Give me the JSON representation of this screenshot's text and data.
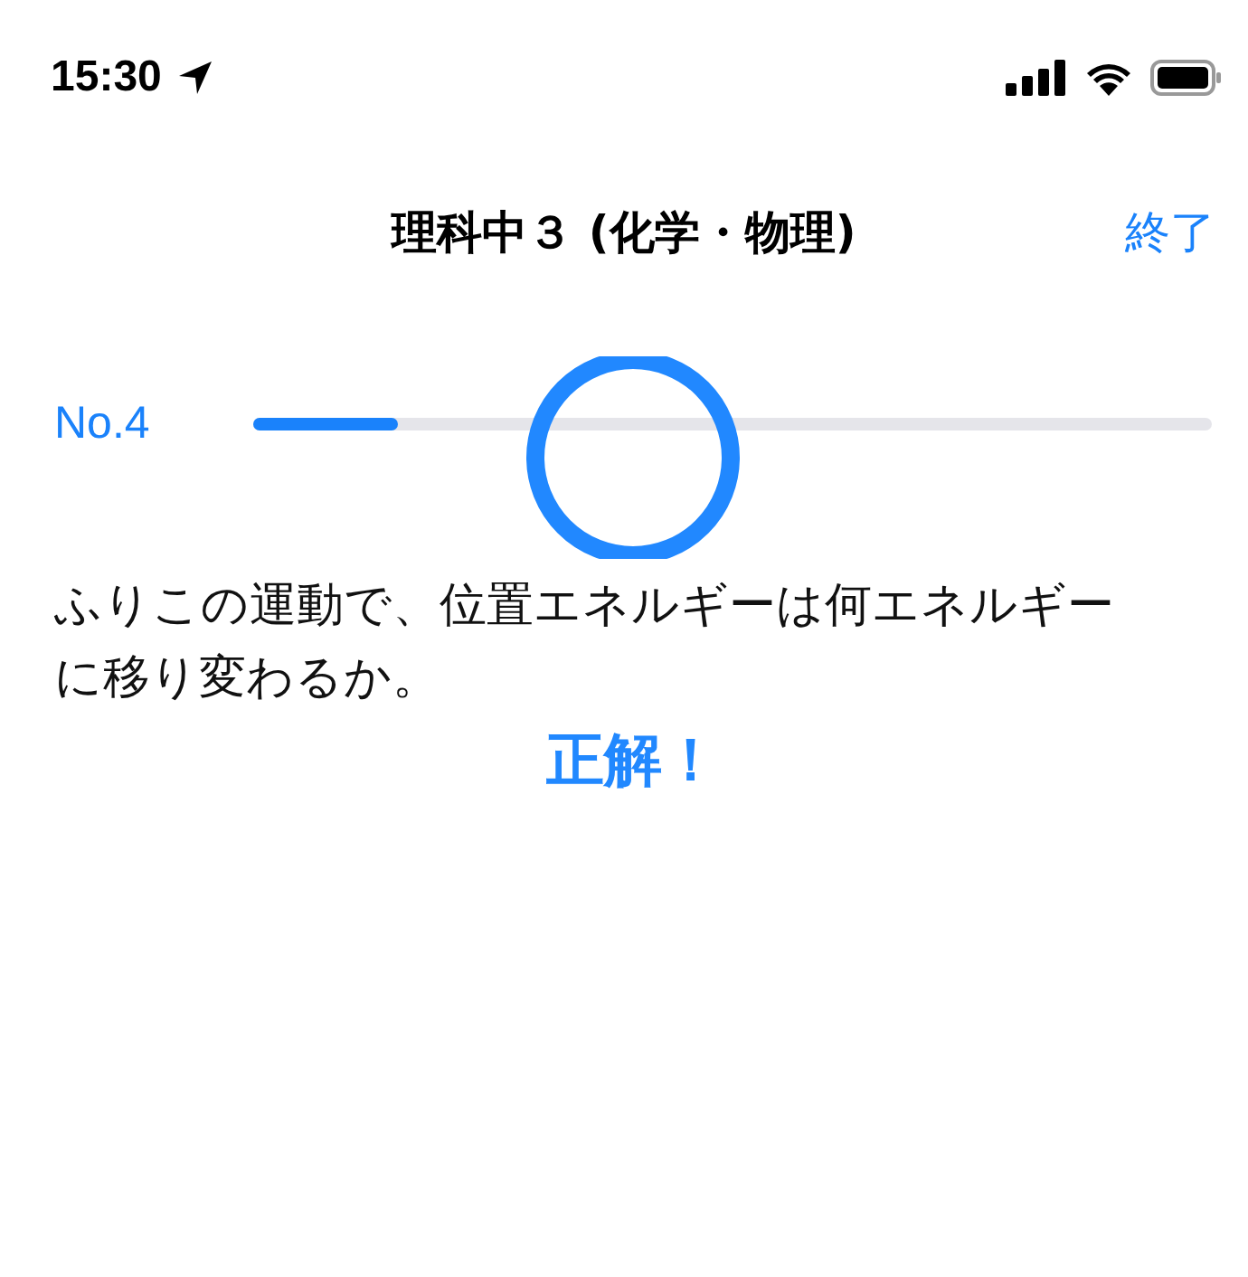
{
  "status_bar": {
    "time": "15:30"
  },
  "nav": {
    "title": "理科中３ (化学・物理)",
    "action": "終了"
  },
  "progress": {
    "label": "No.4",
    "level": 0.15
  },
  "question": {
    "text": "ふりこの運動で、位置エネルギーは何エネルギーに移り変わるか。"
  },
  "result": {
    "correct": true,
    "label": "正解！"
  }
}
